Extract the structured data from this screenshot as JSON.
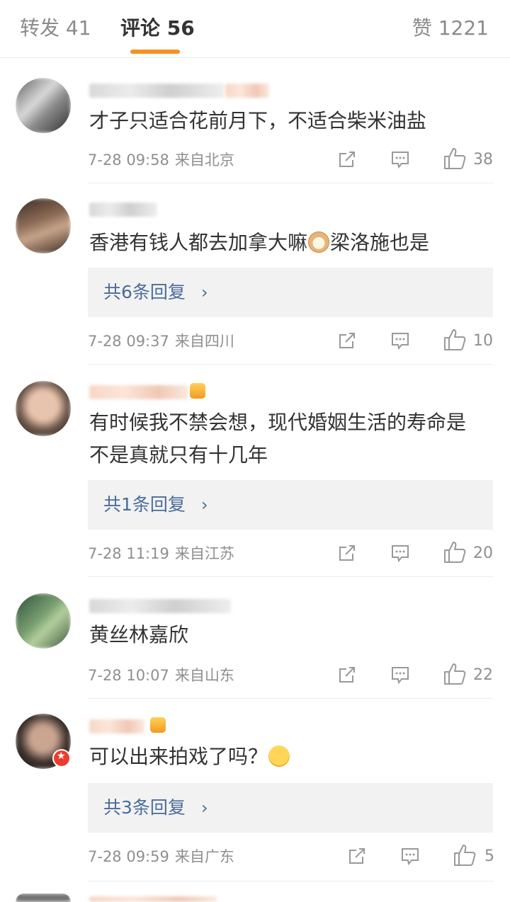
{
  "tabs": {
    "repost": "转发 41",
    "comments": "评论 56",
    "likes": "赞 1221"
  },
  "comments": [
    {
      "text": "才子只适合花前月下，不适合柴米油盐",
      "time": "7-28 09:58",
      "source": "来自北京",
      "likes": "38"
    },
    {
      "text_before_emoji": "香港有钱人都去加拿大嘛",
      "emoji": "cat-face-emoji",
      "text_after_emoji": "梁洛施也是",
      "replies": "共6条回复",
      "time": "7-28 09:37",
      "source": "来自四川",
      "likes": "10"
    },
    {
      "text": "有时候我不禁会想，现代婚姻生活的寿命是不是真就只有十几年",
      "replies": "共1条回复",
      "time": "7-28 11:19",
      "source": "来自江苏",
      "likes": "20"
    },
    {
      "text": "黄丝林嘉欣",
      "time": "7-28 10:07",
      "source": "来自山东",
      "likes": "22"
    },
    {
      "text": "可以出来拍戏了吗？",
      "emoji": "hug-emoji",
      "replies": "共3条回复",
      "time": "7-28 09:59",
      "source": "来自广东",
      "likes": "5"
    }
  ],
  "colors": {
    "accent": "#f79123",
    "link": "#4a6c9b",
    "meta": "#8f8f8f",
    "verified": "#ea3d30"
  },
  "icons": {
    "share": "share-icon",
    "comment": "comment-icon",
    "like": "thumbs-up-icon",
    "chevron": "chevron-right-icon"
  }
}
